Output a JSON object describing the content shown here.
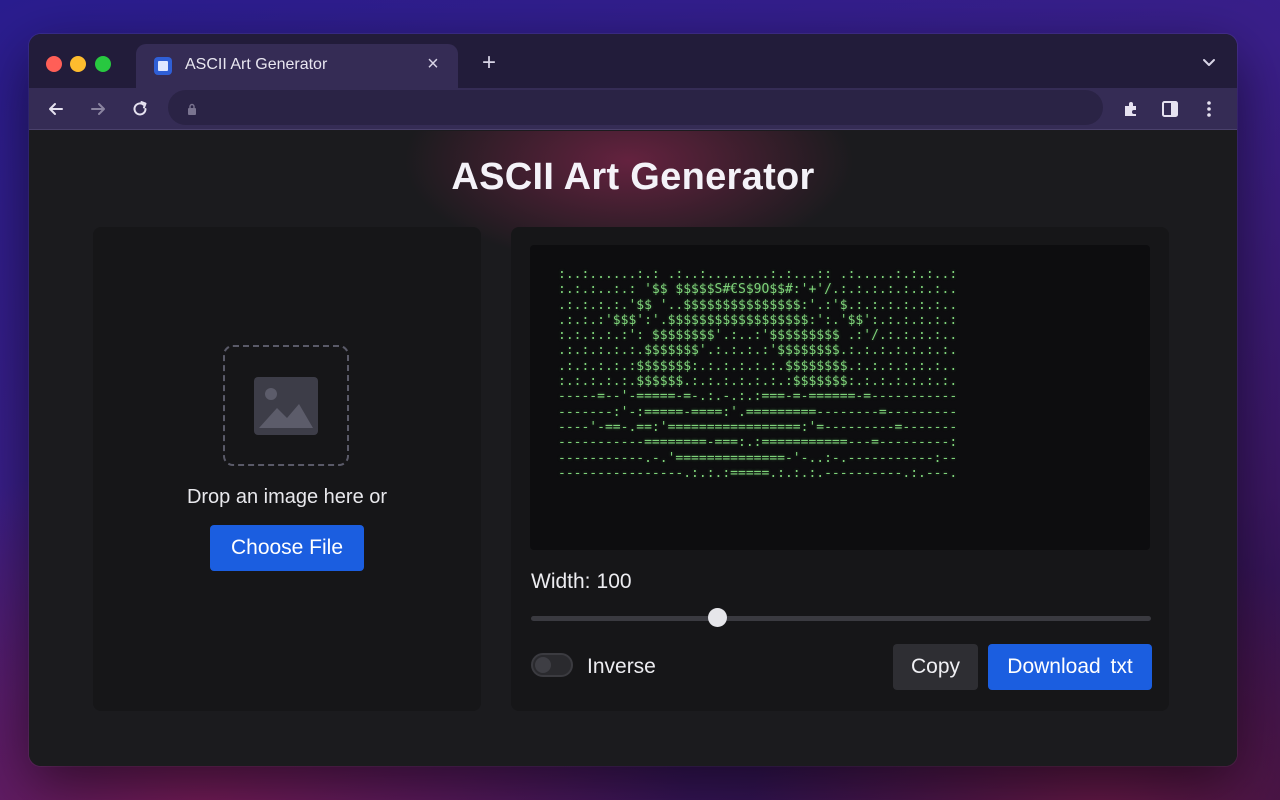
{
  "browser": {
    "tab_title": "ASCII Art Generator",
    "tab_close": "×",
    "new_tab": "+",
    "address": "",
    "icons": [
      "back-arrow-icon",
      "forward-arrow-icon",
      "reload-icon",
      "lock-icon",
      "extensions-icon",
      "sidebar-icon",
      "kebab-menu-icon",
      "chevron-down-icon"
    ]
  },
  "page": {
    "title": "ASCII Art Generator"
  },
  "upload": {
    "prompt": "Drop an image here or",
    "button_label": "Choose File",
    "icon": "image-icon"
  },
  "output": {
    "ascii_lines": [
      ":..:......:.: .:..:........:.:...:: .:.....:.:.:..:",
      ":.:.:..:.: '$$ $$$$$S#€S$9O$$#:'+'/.:.:.:.:.:.:.:..",
      ".:.:.:.:.'$$ '..$$$$$$$$$$$$$$$:'.:'$.:.:.:.:.:.:..",
      ".:.:.:'$$$':'.$$$$$$$$$$$$$$$$$$:':.'$$':.:.:.:.:.:",
      ":.:.:.:.:': $$$$$$$$'.:..:'$$$$$$$$$ .:'/.:.:.:.:..",
      ".:.:.:.:.:.$$$$$$$'.:.:.:.:'$$$$$$$$.:.:.:.:.:.:.:.",
      ".:.:.:.:.:$$$$$$$:.:.:.:.:.:.$$$$$$$$.:.:.:.:.:.:..",
      ":.:.:.:.:.$$$$$$.:.:.:.:.:.:.:$$$$$$$:.:.:.:.:.:.:.",
      "-----=--'-=====-=-.:.-.:.:===-=-======-=-----------",
      "-------:'-:=====-====:'.=========--------=---------",
      "----'-==-.==:'=================:'=---------=-------",
      "-----------========-===:.:===========---=---------:",
      "-----------.-.'==============-'-..:-.-----------:--",
      "----------------.:.:.:=====.:.:.:.----------.:.---."
    ],
    "width_label": "Width:",
    "width_value": "100",
    "slider_fraction": 0.3,
    "inverse_label": "Inverse",
    "inverse_on": false,
    "copy_label": "Copy",
    "download_label": "Download txt"
  },
  "colors": {
    "accent": "#1b5ee0",
    "ascii_green": "#7fd37a",
    "panel": "#161618"
  }
}
